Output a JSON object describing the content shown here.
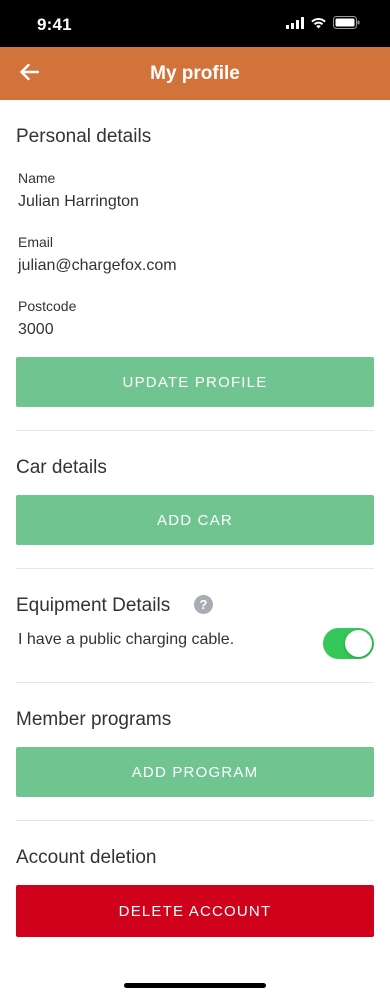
{
  "status_bar": {
    "time": "9:41",
    "icons": [
      "signal-icon",
      "wifi-icon",
      "battery-icon"
    ]
  },
  "header": {
    "title": "My profile",
    "back_icon": "arrow-left-icon"
  },
  "personal": {
    "title": "Personal details",
    "name_label": "Name",
    "name_value": "Julian Harrington",
    "email_label": "Email",
    "email_value": "julian@chargefox.com",
    "postcode_label": "Postcode",
    "postcode_value": "3000",
    "update_button": "UPDATE PROFILE"
  },
  "car": {
    "title": "Car details",
    "add_button": "ADD CAR"
  },
  "equipment": {
    "title": "Equipment Details",
    "help_icon": "help-icon",
    "cable_label": "I have a public charging cable.",
    "cable_toggle_on": true
  },
  "member": {
    "title": "Member programs",
    "add_button": "ADD PROGRAM"
  },
  "account": {
    "title": "Account deletion",
    "delete_button": "DELETE ACCOUNT"
  },
  "colors": {
    "header": "#d1733a",
    "primary_button": "#6fc490",
    "danger_button": "#d0021b",
    "toggle_on": "#34c759"
  }
}
